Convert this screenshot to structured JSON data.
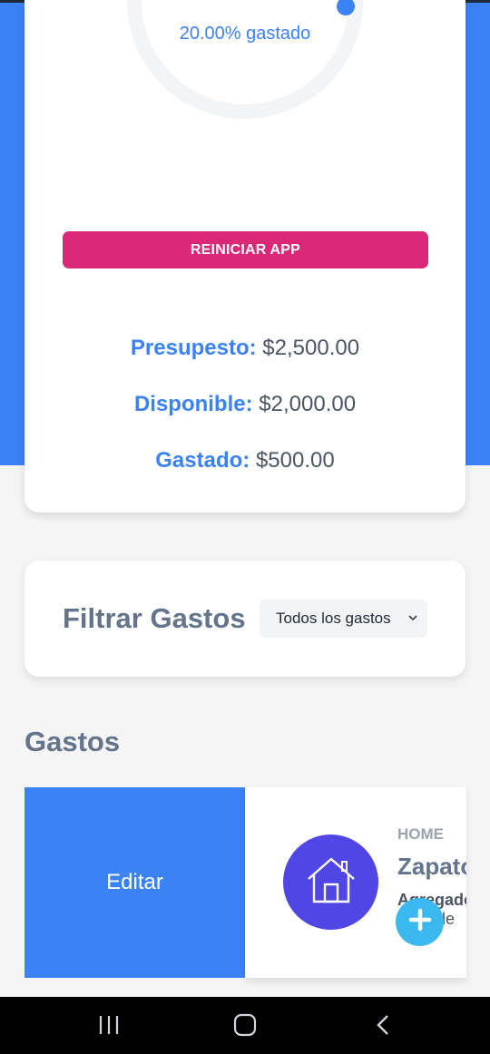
{
  "budget": {
    "progress_text": "20.00% gastado",
    "percent_spent": 20,
    "reset_label": "REINICIAR APP",
    "budget_label": "Presupesto:",
    "budget_value": "$2,500.00",
    "available_label": "Disponible:",
    "available_value": "$2,000.00",
    "spent_label": "Gastado:",
    "spent_value": "$500.00"
  },
  "filter": {
    "title": "Filtrar Gastos",
    "selected": "Todos los gastos"
  },
  "expenses": {
    "title": "Gastos",
    "edit_label": "Editar",
    "item": {
      "category": "HOME",
      "name": "Zapatos",
      "date_label": "Agregado",
      "date_text": "o de"
    }
  },
  "colors": {
    "primary": "#3b82f6",
    "reset": "#db2777",
    "category_icon": "#4f46e5",
    "fab": "#3bb9ef"
  },
  "icons": {
    "category": "home-icon",
    "fab": "plus-icon",
    "nav": [
      "recent-apps-icon",
      "home-nav-icon",
      "back-icon"
    ]
  }
}
